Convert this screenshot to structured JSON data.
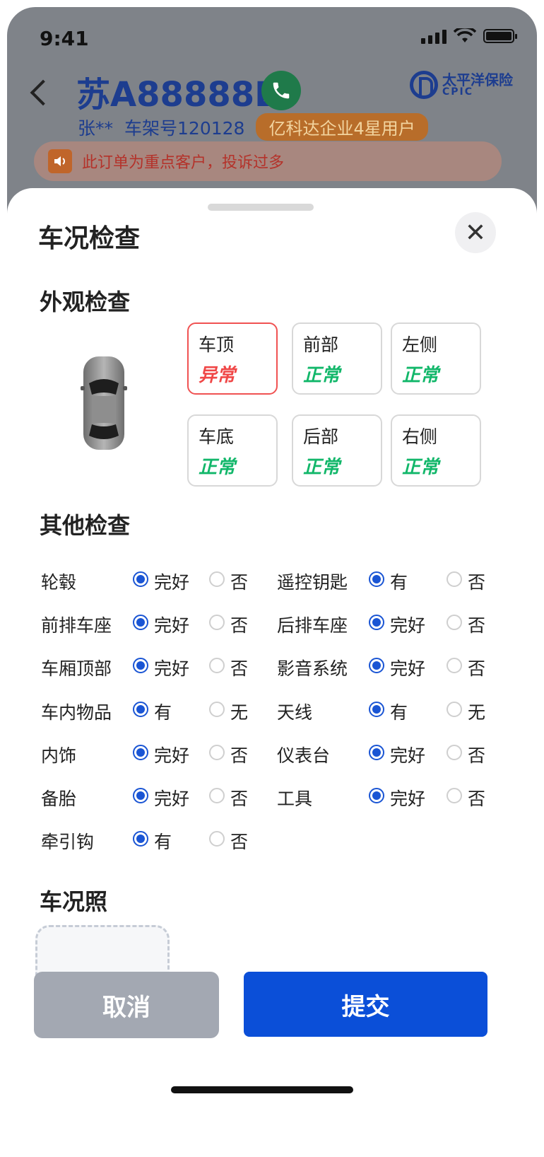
{
  "status_bar": {
    "time": "9:41"
  },
  "header": {
    "plate": "苏A88888L",
    "owner": "张**",
    "vin_label": "车架号120128",
    "vip_badge": "亿科达企业4星用户",
    "insurer": {
      "cn": "太平洋保险",
      "en": "CPIC"
    },
    "alert": "此订单为重点客户，投诉过多"
  },
  "sheet": {
    "title": "车况检查",
    "exterior": {
      "title": "外观检查",
      "items": [
        {
          "label": "车顶",
          "status": "异常",
          "ok": false
        },
        {
          "label": "前部",
          "status": "正常",
          "ok": true
        },
        {
          "label": "左侧",
          "status": "正常",
          "ok": true
        },
        {
          "label": "车底",
          "status": "正常",
          "ok": true
        },
        {
          "label": "后部",
          "status": "正常",
          "ok": true
        },
        {
          "label": "右侧",
          "status": "正常",
          "ok": true
        }
      ]
    },
    "other": {
      "title": "其他检查",
      "rows": [
        {
          "left": {
            "label": "轮毂",
            "opt1": "完好",
            "opt2": "否"
          },
          "right": {
            "label": "遥控钥匙",
            "opt1": "有",
            "opt2": "否"
          }
        },
        {
          "left": {
            "label": "前排车座",
            "opt1": "完好",
            "opt2": "否"
          },
          "right": {
            "label": "后排车座",
            "opt1": "完好",
            "opt2": "否"
          }
        },
        {
          "left": {
            "label": "车厢顶部",
            "opt1": "完好",
            "opt2": "否"
          },
          "right": {
            "label": "影音系统",
            "opt1": "完好",
            "opt2": "否"
          }
        },
        {
          "left": {
            "label": "车内物品",
            "opt1": "有",
            "opt2": "无"
          },
          "right": {
            "label": "天线",
            "opt1": "有",
            "opt2": "无"
          }
        },
        {
          "left": {
            "label": "内饰",
            "opt1": "完好",
            "opt2": "否"
          },
          "right": {
            "label": "仪表台",
            "opt1": "完好",
            "opt2": "否"
          }
        },
        {
          "left": {
            "label": "备胎",
            "opt1": "完好",
            "opt2": "否"
          },
          "right": {
            "label": "工具",
            "opt1": "完好",
            "opt2": "否"
          }
        },
        {
          "left": {
            "label": "牵引钩",
            "opt1": "有",
            "opt2": "否"
          }
        }
      ]
    },
    "photos": {
      "title": "车况照"
    },
    "actions": {
      "cancel": "取消",
      "submit": "提交"
    }
  },
  "colors": {
    "accent": "#0b4fd8",
    "ok": "#12b76a",
    "bad": "#f04747"
  }
}
